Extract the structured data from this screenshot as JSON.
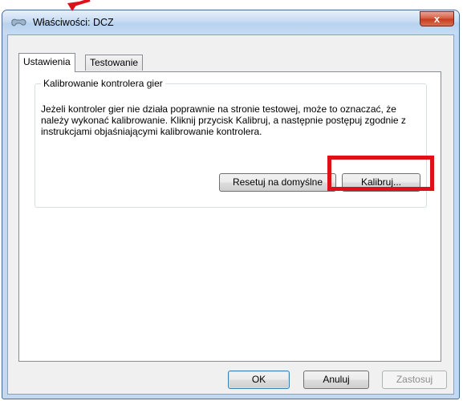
{
  "window": {
    "title": "Właściwości: DCZ",
    "close_label": "x"
  },
  "tabs": [
    {
      "label": "Ustawienia",
      "active": true
    },
    {
      "label": "Testowanie",
      "active": false
    }
  ],
  "calibration_group": {
    "label": "Kalibrowanie kontrolera gier",
    "description": "Jeżeli kontroler gier nie działa poprawnie na stronie testowej, może to oznaczać, że należy wykonać kalibrowanie. Kliknij przycisk Kalibruj, a następnie postępuj zgodnie z instrukcjami objaśniającymi kalibrowanie kontrolera.",
    "reset_label": "Resetuj na domyślne",
    "calibrate_label": "Kalibruj..."
  },
  "footer": {
    "ok_label": "OK",
    "cancel_label": "Anuluj",
    "apply_label": "Zastosuj"
  },
  "annotation": {
    "highlight_color": "#e0101b"
  }
}
